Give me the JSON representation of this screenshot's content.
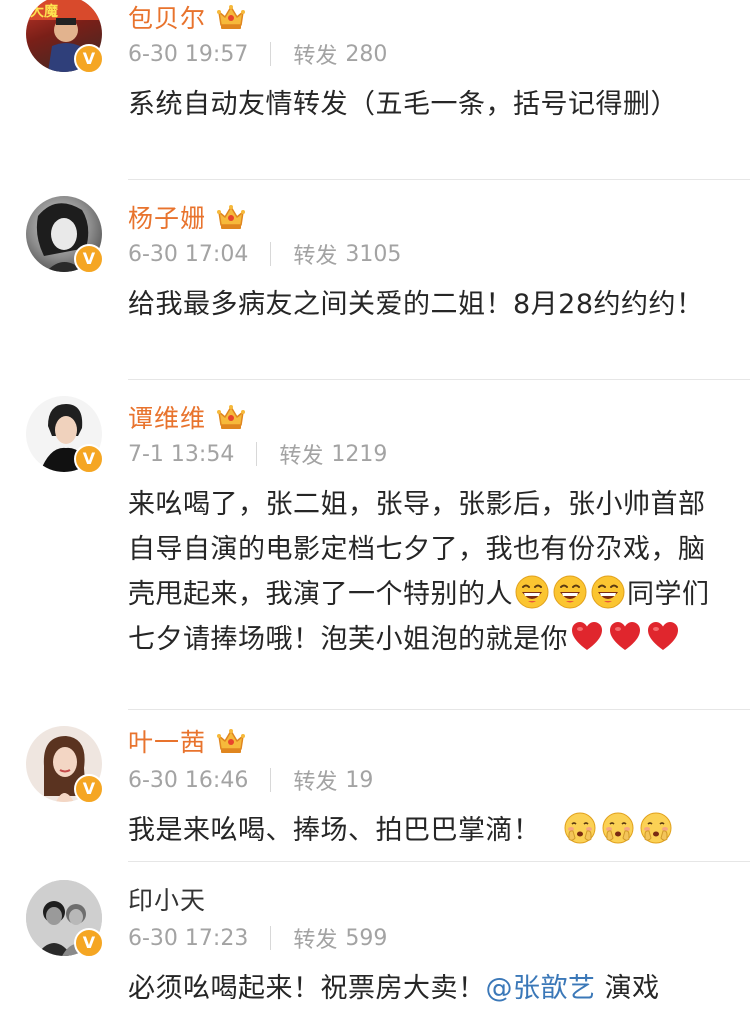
{
  "posts": [
    {
      "name": "包贝尔",
      "vip": true,
      "verified": true,
      "date": "6-30 19:57",
      "repost_label": "转发",
      "repost_count": "280",
      "text": "系统自动友情转发（五毛一条，括号记得删）"
    },
    {
      "name": "杨子姗",
      "vip": true,
      "verified": true,
      "date": "6-30 17:04",
      "repost_label": "转发",
      "repost_count": "3105",
      "text": "给我最多病友之间关爱的二姐！8月28约约约！"
    },
    {
      "name": "谭维维",
      "vip": true,
      "verified": true,
      "date": "7-1 13:54",
      "repost_label": "转发",
      "repost_count": "1219",
      "text_part1": "来吆喝了，张二姐，张导，张影后，张小帅首部自导自演的电影定档七夕了，我也有份尕戏，脑壳甩起来，我演了一个特别的人",
      "text_part2": "同学们七夕请捧场哦！泡芙小姐泡的就是你",
      "emoji_laugh": "grinning-face-emoji",
      "emoji_heart": "red-heart-emoji"
    },
    {
      "name": "叶一茜",
      "vip": true,
      "verified": true,
      "date": "6-30 16:46",
      "repost_label": "转发",
      "repost_count": "19",
      "text": "我是来吆喝、捧场、拍巴巴掌滴！",
      "emoji_clap": "hands-over-face-emoji"
    },
    {
      "name": "印小天",
      "vip": false,
      "verified": true,
      "date": "6-30 17:23",
      "repost_label": "转发",
      "repost_count": "599",
      "text_part1": "必须吆喝起来！祝票房大卖！",
      "mention": "@张歆艺",
      "text_part2": " 演戏"
    }
  ],
  "colors": {
    "vip_name": "#e8732d",
    "meta": "#a3a3a3",
    "mention": "#3b78b8",
    "verified_badge": "#f5a623",
    "heart": "#e0262d"
  }
}
